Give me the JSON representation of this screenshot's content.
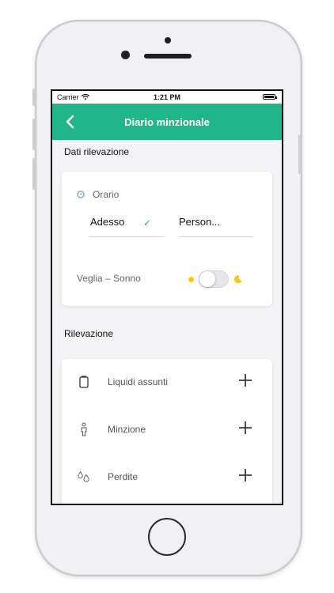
{
  "statusbar": {
    "carrier": "Carrier",
    "time": "1:21 PM"
  },
  "navbar": {
    "title": "Diario minzionale",
    "back_icon": "chevron-left-icon"
  },
  "section_dati": {
    "title": "Dati rilevazione"
  },
  "card_dati": {
    "orario_label": "Orario",
    "option_now": "Adesso",
    "option_custom": "Person...",
    "veglia_label": "Veglia – Sonno",
    "sleep_toggle_on": false
  },
  "section_rilevazione": {
    "title": "Rilevazione"
  },
  "rilevazione_items": [
    {
      "label": "Liquidi assunti",
      "icon": "glass-icon"
    },
    {
      "label": "Minzione",
      "icon": "person-icon"
    },
    {
      "label": "Perdite",
      "icon": "drops-icon"
    }
  ],
  "colors": {
    "accent": "#21b58a",
    "sun": "#f5c518"
  }
}
